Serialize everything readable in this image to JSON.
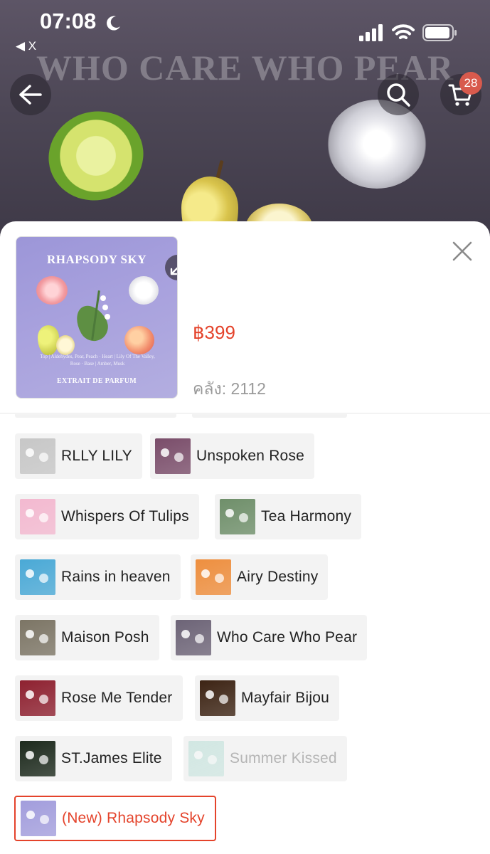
{
  "status_bar": {
    "time": "07:08",
    "back_app_label": "◀ X"
  },
  "hero": {
    "banner_title": "WHO CARE WHO PEAR",
    "cart_count": "28"
  },
  "product": {
    "thumb_title": "RHAPSODY SKY",
    "thumb_notes": "Top | Aldehydes, Pear, Peach · Heart | Lily Of The Valley, Rose · Base | Amber, Musk",
    "thumb_footer": "EXTRAIT DE PARFUM",
    "price": "฿399",
    "stock": "คลัง: 2112"
  },
  "colors": {
    "accent": "#e4432b",
    "chip_bg": "#f3f3f3",
    "badge": "#d85a4d"
  },
  "variants": [
    {
      "label": "RLLY LILY",
      "thumb_color": "#c7c7c7",
      "state": "normal"
    },
    {
      "label": "Unspoken Rose",
      "thumb_color": "#7a4d6a",
      "state": "normal"
    },
    {
      "label": "Whispers Of Tulips",
      "thumb_color": "#f3b9d0",
      "state": "normal"
    },
    {
      "label": "Tea Harmony",
      "thumb_color": "#6f8f6a",
      "state": "normal"
    },
    {
      "label": "Rains in heaven",
      "thumb_color": "#4aa9d6",
      "state": "normal"
    },
    {
      "label": "Airy Destiny",
      "thumb_color": "#ee8f3f",
      "state": "normal"
    },
    {
      "label": "Maison Posh",
      "thumb_color": "#7c7565",
      "state": "normal"
    },
    {
      "label": "Who Care Who Pear",
      "thumb_color": "#6d6477",
      "state": "normal"
    },
    {
      "label": "Rose Me Tender",
      "thumb_color": "#8e2130",
      "state": "normal"
    },
    {
      "label": "Mayfair Bijou",
      "thumb_color": "#3d2414",
      "state": "normal"
    },
    {
      "label": "ST.James Elite",
      "thumb_color": "#1d2a1d",
      "state": "normal"
    },
    {
      "label": "Summer Kissed",
      "thumb_color": "#a9d9cf",
      "state": "disabled"
    },
    {
      "label": "(New) Rhapsody Sky",
      "thumb_color": "#a29ddc",
      "state": "selected"
    }
  ]
}
